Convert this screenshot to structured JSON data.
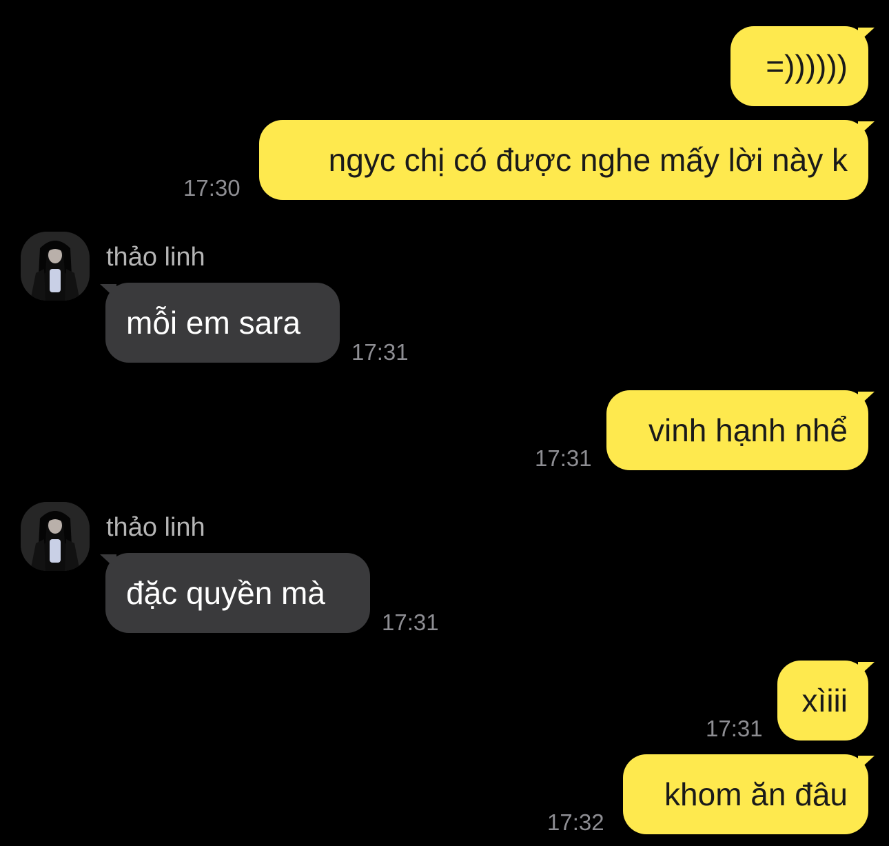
{
  "conversation": {
    "contact_name": "thảo linh",
    "messages": [
      {
        "direction": "sent",
        "text": "=))))))",
        "time": ""
      },
      {
        "direction": "sent",
        "text": "ngyc chị có được nghe mấy lời này k",
        "time": "17:30"
      },
      {
        "direction": "received",
        "sender": "thảo linh",
        "text": "mỗi em sara",
        "time": "17:31"
      },
      {
        "direction": "sent",
        "text": "vinh hạnh nhể",
        "time": "17:31"
      },
      {
        "direction": "received",
        "sender": "thảo linh",
        "text": "đặc quyền mà",
        "time": "17:31"
      },
      {
        "direction": "sent",
        "text": "xìiii",
        "time": "17:31"
      },
      {
        "direction": "sent",
        "text": "khom ăn đâu",
        "time": "17:32"
      }
    ]
  },
  "colors": {
    "background": "#000000",
    "sent_bubble": "#FEE94E",
    "received_bubble": "#3A3A3C",
    "timestamp": "#8E8E93"
  }
}
